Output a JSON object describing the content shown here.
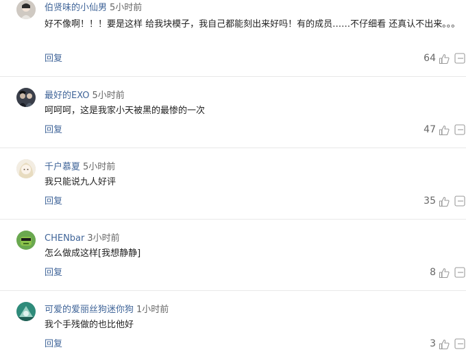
{
  "comments": [
    {
      "user": "伯贤味的小仙男",
      "time": "5小时前",
      "text": "好不像啊！！！要是这样 给我块模子，我自己都能刻出来好吗！有的成员……不仔细看 还真认不出来。。。",
      "reply_label": "回复",
      "likes": "64"
    },
    {
      "user": "最好的EXO",
      "time": "5小时前",
      "text": "呵呵呵，这是我家小天被黑的最惨的一次",
      "reply_label": "回复",
      "likes": "47"
    },
    {
      "user": "千户慕夏",
      "time": "5小时前",
      "text": "我只能说九人好评",
      "reply_label": "回复",
      "likes": "35"
    },
    {
      "user": "CHENbar",
      "time": "3小时前",
      "text": "怎么做成这样[我想静静]",
      "reply_label": "回复",
      "likes": "8"
    },
    {
      "user": "可爱的爱丽丝狗迷你狗",
      "time": "1小时前",
      "text": "我个手残做的也比他好",
      "reply_label": "回复",
      "likes": "3"
    }
  ],
  "colors": {
    "username": "#406599",
    "reply": "#406599",
    "divider": "#e8e8e8"
  }
}
